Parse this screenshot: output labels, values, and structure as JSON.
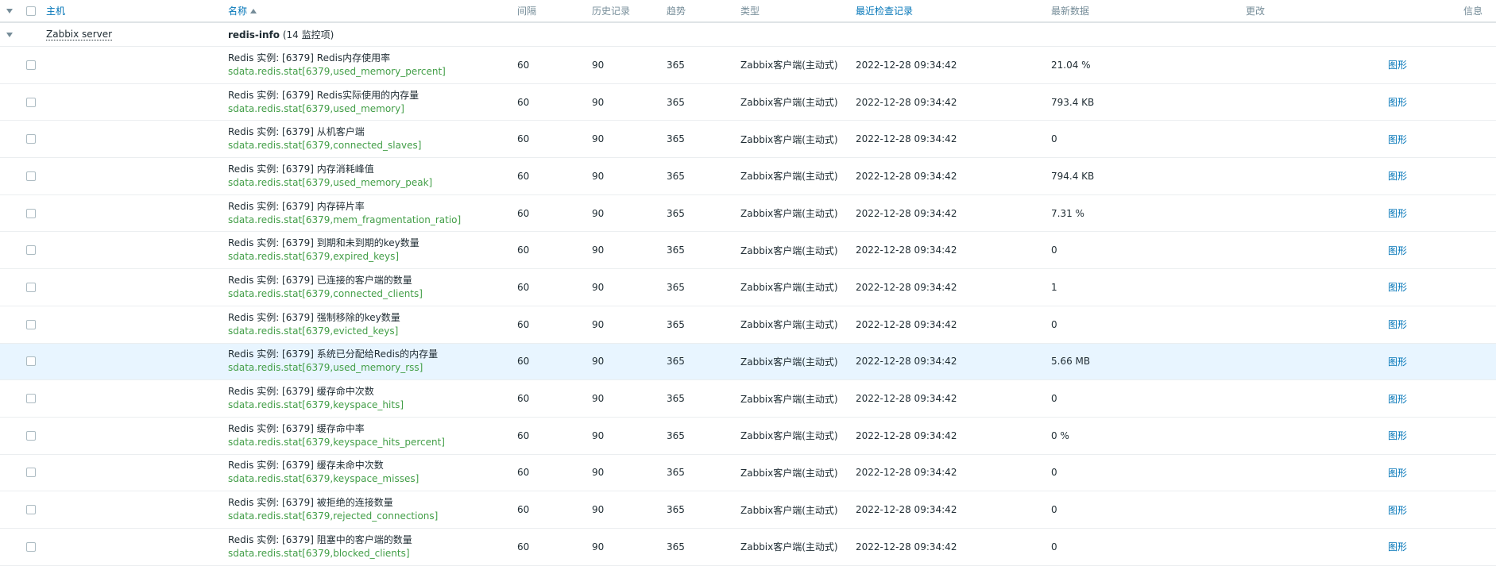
{
  "header": {
    "host": "主机",
    "name": "名称",
    "interval": "间隔",
    "history": "历史记录",
    "trends": "趋势",
    "type": "类型",
    "last_check": "最近检查记录",
    "last_value": "最新数据",
    "change": "更改",
    "info": "信息"
  },
  "group": {
    "host": "Zabbix server",
    "app_name": "redis-info",
    "count": "(14 监控项)"
  },
  "items": [
    {
      "name": "Redis 实例: [6379] Redis内存使用率",
      "key": "sdata.redis.stat[6379,used_memory_percent]",
      "interval": "60",
      "history": "90",
      "trends": "365",
      "type": "Zabbix客户端(主动式)",
      "last_check": "2022-12-28 09:34:42",
      "last_value": "21.04 %",
      "action": "图形"
    },
    {
      "name": "Redis 实例: [6379] Redis实际使用的内存量",
      "key": "sdata.redis.stat[6379,used_memory]",
      "interval": "60",
      "history": "90",
      "trends": "365",
      "type": "Zabbix客户端(主动式)",
      "last_check": "2022-12-28 09:34:42",
      "last_value": "793.4 KB",
      "action": "图形"
    },
    {
      "name": "Redis 实例: [6379] 从机客户端",
      "key": "sdata.redis.stat[6379,connected_slaves]",
      "interval": "60",
      "history": "90",
      "trends": "365",
      "type": "Zabbix客户端(主动式)",
      "last_check": "2022-12-28 09:34:42",
      "last_value": "0",
      "action": "图形"
    },
    {
      "name": "Redis 实例: [6379] 内存消耗峰值",
      "key": "sdata.redis.stat[6379,used_memory_peak]",
      "interval": "60",
      "history": "90",
      "trends": "365",
      "type": "Zabbix客户端(主动式)",
      "last_check": "2022-12-28 09:34:42",
      "last_value": "794.4 KB",
      "action": "图形"
    },
    {
      "name": "Redis 实例: [6379] 内存碎片率",
      "key": "sdata.redis.stat[6379,mem_fragmentation_ratio]",
      "interval": "60",
      "history": "90",
      "trends": "365",
      "type": "Zabbix客户端(主动式)",
      "last_check": "2022-12-28 09:34:42",
      "last_value": "7.31 %",
      "action": "图形"
    },
    {
      "name": "Redis 实例: [6379] 到期和未到期的key数量",
      "key": "sdata.redis.stat[6379,expired_keys]",
      "interval": "60",
      "history": "90",
      "trends": "365",
      "type": "Zabbix客户端(主动式)",
      "last_check": "2022-12-28 09:34:42",
      "last_value": "0",
      "action": "图形"
    },
    {
      "name": "Redis 实例: [6379] 已连接的客户端的数量",
      "key": "sdata.redis.stat[6379,connected_clients]",
      "interval": "60",
      "history": "90",
      "trends": "365",
      "type": "Zabbix客户端(主动式)",
      "last_check": "2022-12-28 09:34:42",
      "last_value": "1",
      "action": "图形"
    },
    {
      "name": "Redis 实例: [6379] 强制移除的key数量",
      "key": "sdata.redis.stat[6379,evicted_keys]",
      "interval": "60",
      "history": "90",
      "trends": "365",
      "type": "Zabbix客户端(主动式)",
      "last_check": "2022-12-28 09:34:42",
      "last_value": "0",
      "action": "图形"
    },
    {
      "name": "Redis 实例: [6379] 系统已分配给Redis的内存量",
      "key": "sdata.redis.stat[6379,used_memory_rss]",
      "interval": "60",
      "history": "90",
      "trends": "365",
      "type": "Zabbix客户端(主动式)",
      "last_check": "2022-12-28 09:34:42",
      "last_value": "5.66 MB",
      "action": "图形",
      "highlight": true
    },
    {
      "name": "Redis 实例: [6379] 缓存命中次数",
      "key": "sdata.redis.stat[6379,keyspace_hits]",
      "interval": "60",
      "history": "90",
      "trends": "365",
      "type": "Zabbix客户端(主动式)",
      "last_check": "2022-12-28 09:34:42",
      "last_value": "0",
      "action": "图形"
    },
    {
      "name": "Redis 实例: [6379] 缓存命中率",
      "key": "sdata.redis.stat[6379,keyspace_hits_percent]",
      "interval": "60",
      "history": "90",
      "trends": "365",
      "type": "Zabbix客户端(主动式)",
      "last_check": "2022-12-28 09:34:42",
      "last_value": "0 %",
      "action": "图形"
    },
    {
      "name": "Redis 实例: [6379] 缓存未命中次数",
      "key": "sdata.redis.stat[6379,keyspace_misses]",
      "interval": "60",
      "history": "90",
      "trends": "365",
      "type": "Zabbix客户端(主动式)",
      "last_check": "2022-12-28 09:34:42",
      "last_value": "0",
      "action": "图形"
    },
    {
      "name": "Redis 实例: [6379] 被拒绝的连接数量",
      "key": "sdata.redis.stat[6379,rejected_connections]",
      "interval": "60",
      "history": "90",
      "trends": "365",
      "type": "Zabbix客户端(主动式)",
      "last_check": "2022-12-28 09:34:42",
      "last_value": "0",
      "action": "图形"
    },
    {
      "name": "Redis 实例: [6379] 阻塞中的客户端的数量",
      "key": "sdata.redis.stat[6379,blocked_clients]",
      "interval": "60",
      "history": "90",
      "trends": "365",
      "type": "Zabbix客户端(主动式)",
      "last_check": "2022-12-28 09:34:42",
      "last_value": "0",
      "action": "图形"
    }
  ]
}
